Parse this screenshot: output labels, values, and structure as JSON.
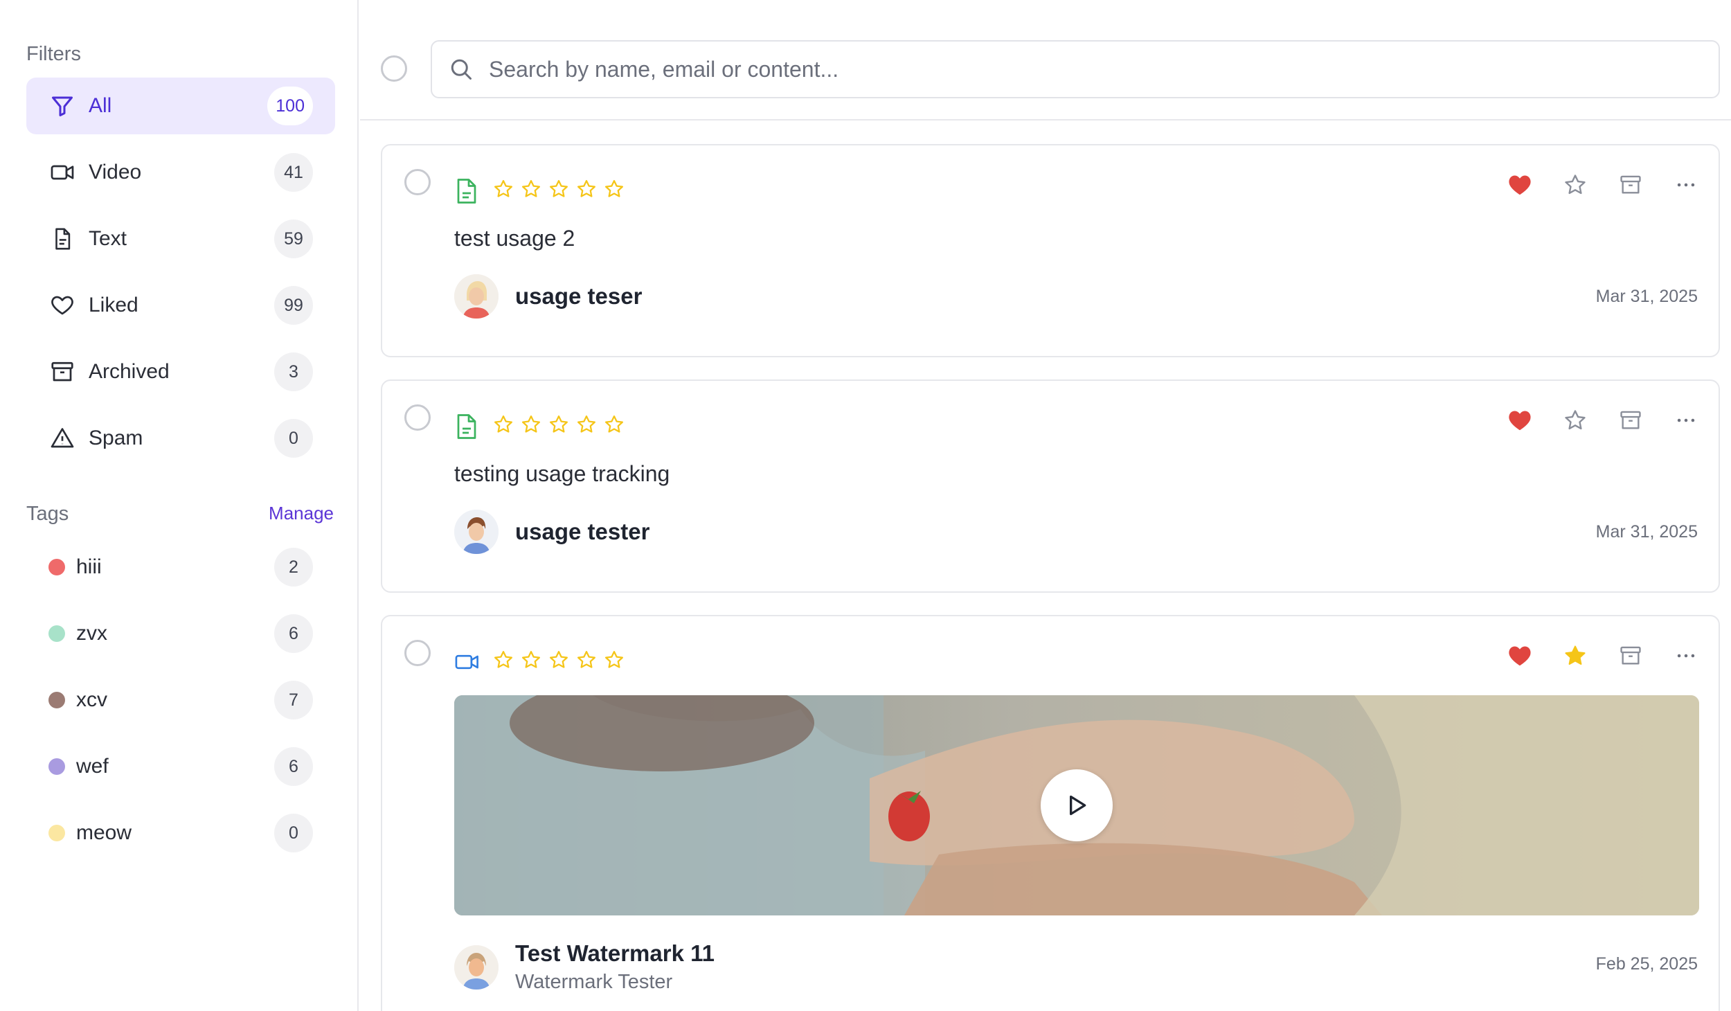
{
  "sidebar": {
    "filters_heading": "Filters",
    "filters": [
      {
        "label": "All",
        "count": "100",
        "icon": "filter-icon",
        "active": true
      },
      {
        "label": "Video",
        "count": "41",
        "icon": "video-icon"
      },
      {
        "label": "Text",
        "count": "59",
        "icon": "document-icon"
      },
      {
        "label": "Liked",
        "count": "99",
        "icon": "heart-icon"
      },
      {
        "label": "Archived",
        "count": "3",
        "icon": "archive-icon"
      },
      {
        "label": "Spam",
        "count": "0",
        "icon": "warning-icon"
      }
    ],
    "tags_heading": "Tags",
    "manage_label": "Manage",
    "tags": [
      {
        "label": "hiii",
        "count": "2",
        "color": "#ef6a6a"
      },
      {
        "label": "zvx",
        "count": "6",
        "color": "#a8e2c9"
      },
      {
        "label": "xcv",
        "count": "7",
        "color": "#9b7b73"
      },
      {
        "label": "wef",
        "count": "6",
        "color": "#a99be0"
      },
      {
        "label": "meow",
        "count": "0",
        "color": "#fbe7a1"
      }
    ]
  },
  "search": {
    "placeholder": "Search by name, email or content..."
  },
  "colors": {
    "accent": "#4c2fd6",
    "liked": "#e0453f",
    "star": "#f5c518",
    "text_type": "#3bb35e",
    "video_type": "#2f7de1"
  },
  "cards": [
    {
      "type": "text",
      "content": "test usage 2",
      "author": "usage teser",
      "date": "Mar 31, 2025",
      "liked": true,
      "starred": false
    },
    {
      "type": "text",
      "content": "testing usage tracking",
      "author": "usage tester",
      "date": "Mar 31, 2025",
      "liked": true,
      "starred": false
    },
    {
      "type": "video",
      "title": "Test Watermark 11",
      "subtitle": "Watermark Tester",
      "date": "Feb 25, 2025",
      "liked": true,
      "starred": true
    }
  ]
}
